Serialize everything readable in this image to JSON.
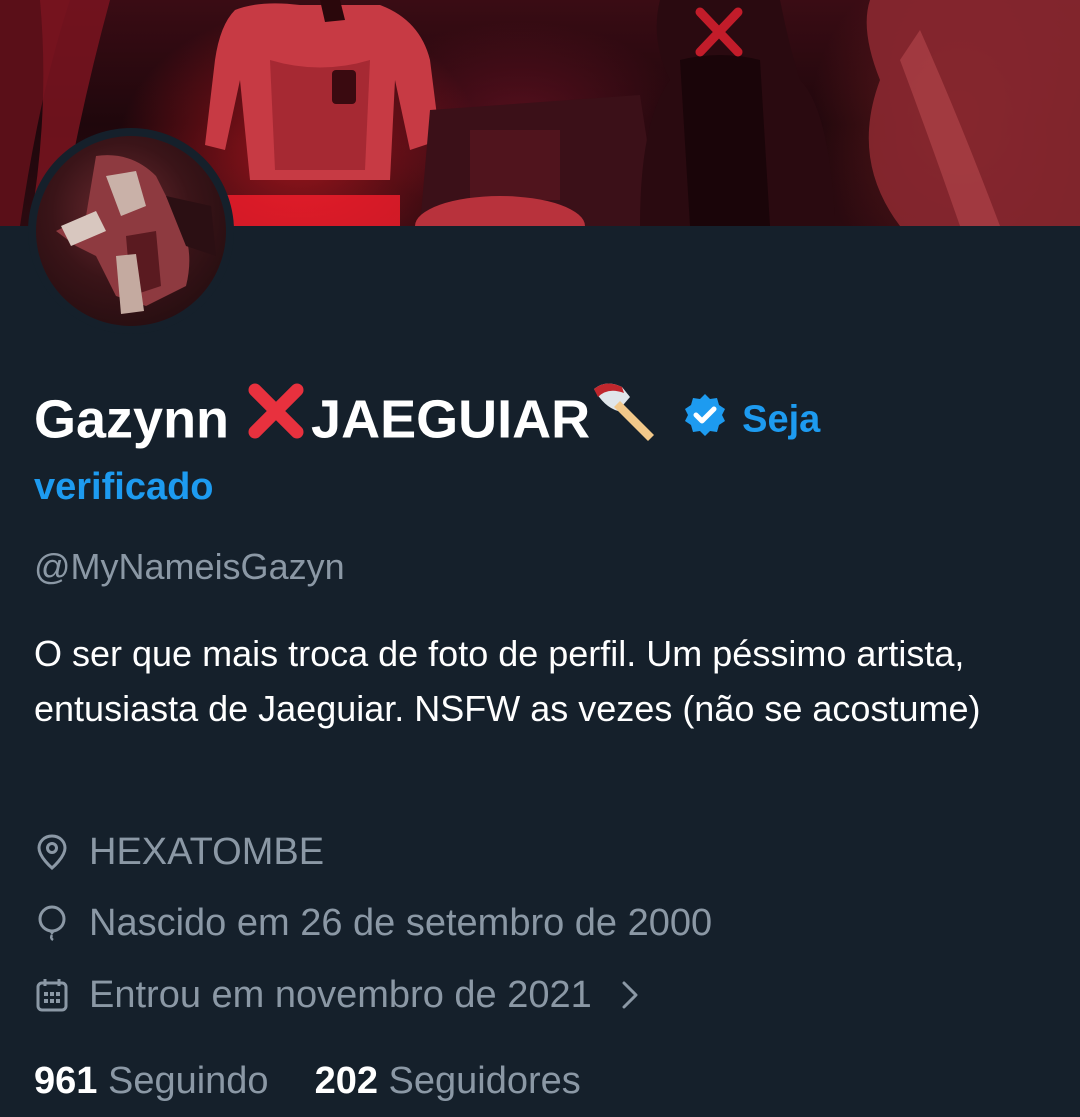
{
  "profile": {
    "display_name": "Gazynn",
    "display_name_suffix": "JAEGUIAR",
    "name_emojis": [
      "cross-mark-icon",
      "axe-icon"
    ],
    "verified_badge_icon": "verified-badge-icon",
    "verify_link_part1": "Seja",
    "verify_link_part2": "verificado",
    "handle": "@MyNameisGazyn",
    "bio": "O ser que mais troca de foto de perfil. Um péssimo artista, entusiasta de Jaeguiar. NSFW as vezes (não se acostume)",
    "location": "HEXATOMBE",
    "birth": "Nascido em 26 de setembro de 2000",
    "joined": "Entrou em novembro de 2021",
    "following_count": "961",
    "following_label": "Seguindo",
    "followers_count": "202",
    "followers_label": "Seguidores"
  },
  "icons": {
    "location": "location-pin-icon",
    "birth": "balloon-icon",
    "joined": "calendar-icon",
    "chevron": "chevron-right-icon"
  },
  "colors": {
    "background": "#15202b",
    "text_primary": "#ffffff",
    "text_secondary": "#8b98a5",
    "accent": "#1d9bf0"
  }
}
